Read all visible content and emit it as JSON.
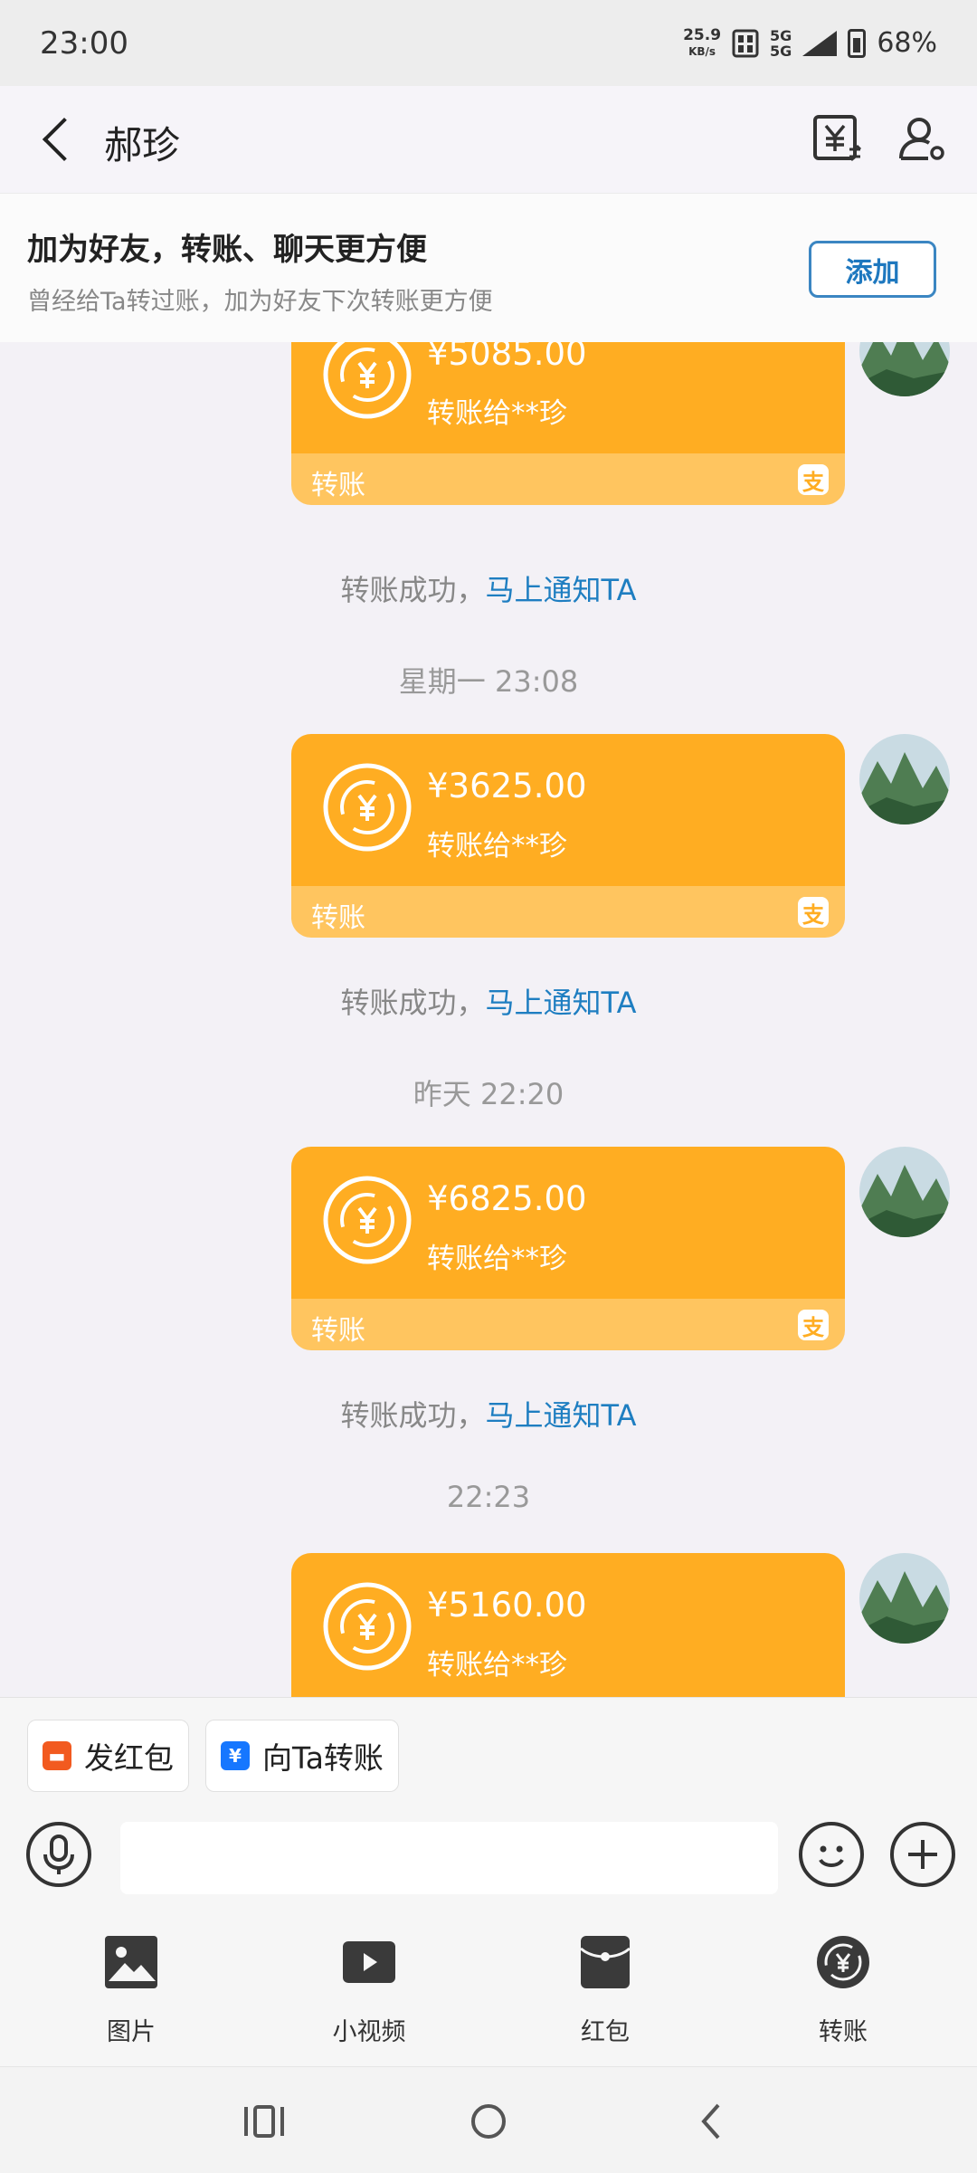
{
  "status_bar": {
    "time": "23:00",
    "net_speed": "25.9",
    "net_unit": "KB/s",
    "signal": "5G",
    "battery": "68%"
  },
  "header": {
    "back_icon": "chevron-left-icon",
    "title": "郝珍",
    "transfer_record_icon": "yuan-record-icon",
    "profile_icon": "person-settings-icon"
  },
  "banner": {
    "title": "加为好友，转账、聊天更方便",
    "subtitle": "曾经给Ta转过账，加为好友下次转账更方便",
    "add_label": "添加"
  },
  "colors": {
    "card_top": "#ffad22",
    "card_bottom": "#ffc55f",
    "link": "#1e7ec1",
    "add_button": "#1e78bf"
  },
  "messages": [
    {
      "amount": "¥5085.00",
      "to": "转账给**珍",
      "label": "转账",
      "notice": "转账成功，",
      "notice_link": "马上通知TA"
    },
    {
      "timestamp": "星期一 23:08",
      "amount": "¥3625.00",
      "to": "转账给**珍",
      "label": "转账",
      "notice": "转账成功，",
      "notice_link": "马上通知TA"
    },
    {
      "timestamp": "昨天 22:20",
      "amount": "¥6825.00",
      "to": "转账给**珍",
      "label": "转账",
      "notice": "转账成功，",
      "notice_link": "马上通知TA"
    },
    {
      "timestamp": "22:23",
      "amount": "¥5160.00",
      "to": "转账给**珍"
    }
  ],
  "quick_actions": [
    {
      "label": "发红包",
      "icon": "red-envelope-icon"
    },
    {
      "label": "向Ta转账",
      "icon": "yuan-transfer-icon"
    }
  ],
  "input": {
    "placeholder": "",
    "voice_icon": "microphone-icon",
    "emoji_icon": "smiley-icon",
    "more_icon": "plus-icon"
  },
  "tools": [
    {
      "label": "图片",
      "icon": "image-icon"
    },
    {
      "label": "小视频",
      "icon": "video-icon"
    },
    {
      "label": "红包",
      "icon": "red-packet-icon"
    },
    {
      "label": "转账",
      "icon": "transfer-yuan-icon"
    }
  ],
  "nav": {
    "recents_icon": "recent-apps-icon",
    "home_icon": "home-circle-icon",
    "back_icon": "nav-back-icon"
  }
}
